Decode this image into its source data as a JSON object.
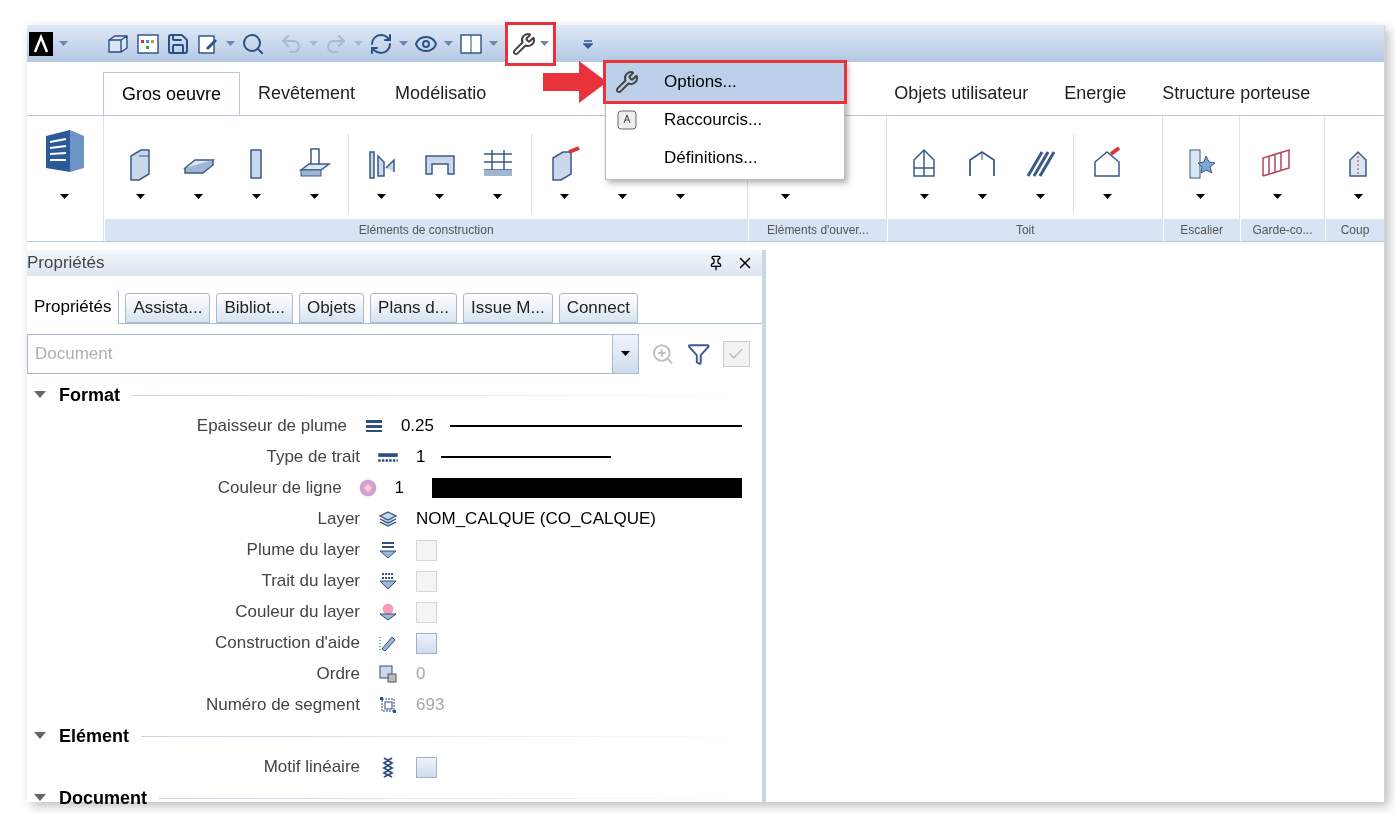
{
  "ribbon_tabs": [
    {
      "label": "Gros oeuvre",
      "selected": true
    },
    {
      "label": "Revêtement",
      "selected": false
    },
    {
      "label": "Modélisatio",
      "selected": false
    },
    {
      "label": "Objets utilisateur",
      "selected": false
    },
    {
      "label": "Energie",
      "selected": false
    },
    {
      "label": "Structure porteuse",
      "selected": false
    }
  ],
  "ribbon_groups": [
    {
      "label": "Eléments de construction"
    },
    {
      "label": "Eléments d'ouver..."
    },
    {
      "label": "Toit"
    },
    {
      "label": "Escalier"
    },
    {
      "label": "Garde-co..."
    },
    {
      "label": "Coup"
    }
  ],
  "tools_menu": {
    "open": true,
    "items": [
      {
        "label": "Options...",
        "selected": true
      },
      {
        "label": "Raccourcis...",
        "selected": false
      },
      {
        "label": "Définitions...",
        "selected": false
      }
    ]
  },
  "panel": {
    "title": "Propriétés",
    "tabs": [
      {
        "label": "Propriétés",
        "selected": true
      },
      {
        "label": "Assista...",
        "selected": false
      },
      {
        "label": "Bibliot...",
        "selected": false
      },
      {
        "label": "Objets",
        "selected": false
      },
      {
        "label": "Plans d...",
        "selected": false
      },
      {
        "label": "Issue M...",
        "selected": false
      },
      {
        "label": "Connect",
        "selected": false
      }
    ],
    "filter": {
      "placeholder": "Document"
    },
    "apply": {
      "checked": true,
      "disabled": true
    },
    "sections": [
      {
        "title": "Format",
        "expanded": true,
        "rows": [
          {
            "label": "Epaisseur de plume",
            "kind": "pen",
            "value": "0.25"
          },
          {
            "label": "Type de trait",
            "kind": "linetype",
            "value": "1"
          },
          {
            "label": "Couleur de ligne",
            "kind": "color",
            "value": "1",
            "color": "#000000"
          },
          {
            "label": "Layer",
            "kind": "text",
            "value": "NOM_CALQUE (CO_CALQUE)",
            "disabled": false
          },
          {
            "label": "Plume du layer",
            "kind": "checkbox",
            "checked": false,
            "disabled": true
          },
          {
            "label": "Trait du layer",
            "kind": "checkbox",
            "checked": false,
            "disabled": true
          },
          {
            "label": "Couleur du layer",
            "kind": "checkbox",
            "checked": false,
            "disabled": true
          },
          {
            "label": "Construction d'aide",
            "kind": "checkbox",
            "checked": false,
            "disabled": false
          },
          {
            "label": "Ordre",
            "kind": "text",
            "value": "0",
            "disabled": true
          },
          {
            "label": "Numéro de segment",
            "kind": "text",
            "value": "693",
            "disabled": true
          }
        ]
      },
      {
        "title": "Elément",
        "expanded": true,
        "rows": [
          {
            "label": "Motif linéaire",
            "kind": "checkbox",
            "checked": false,
            "disabled": false
          }
        ]
      },
      {
        "title": "Document",
        "expanded": true
      }
    ]
  }
}
